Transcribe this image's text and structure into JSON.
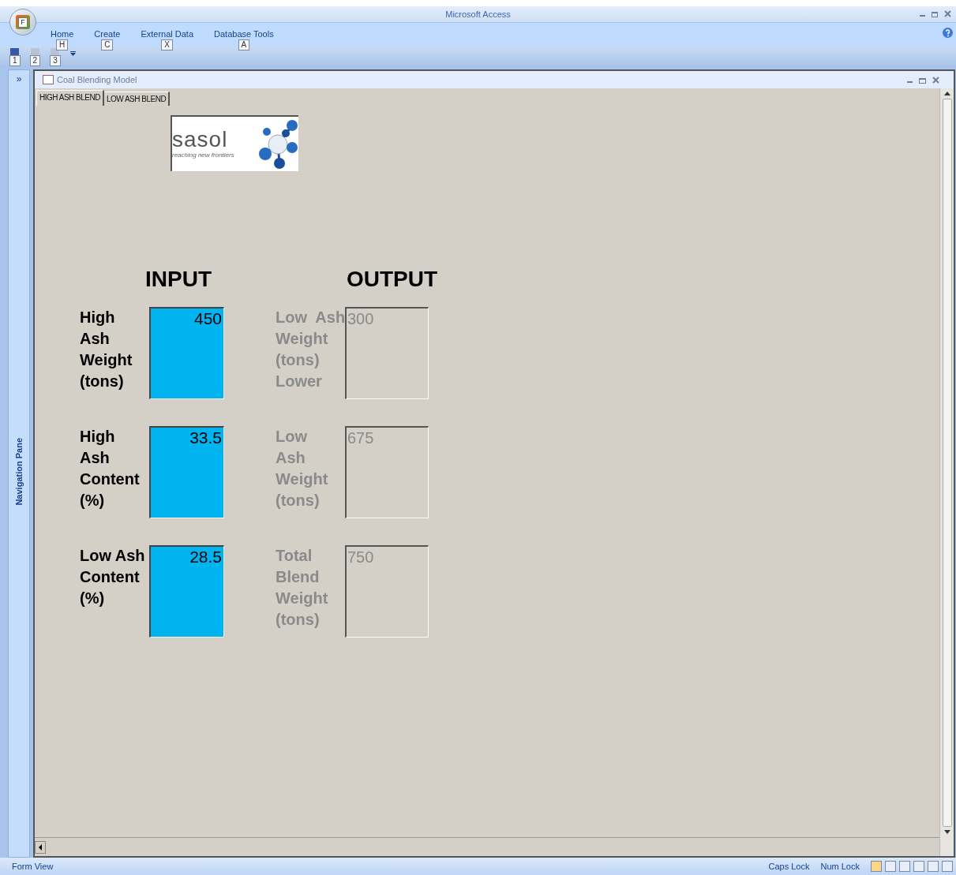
{
  "window": {
    "title": "Microsoft Access",
    "office_button_keytip": "F"
  },
  "ribbon_tabs": [
    {
      "label": "Home",
      "keytip": "H"
    },
    {
      "label": "Create",
      "keytip": "C"
    },
    {
      "label": "External Data",
      "keytip": "X"
    },
    {
      "label": "Database Tools",
      "keytip": "A"
    }
  ],
  "quick_access_keytips": [
    "1",
    "2",
    "3"
  ],
  "navigation_pane": {
    "toggle": "»",
    "label": "Navigation Pane"
  },
  "document": {
    "title": "Coal Blending Model",
    "tabs": [
      {
        "label": "HIGH ASH BLEND",
        "selected": true
      },
      {
        "label": "LOW ASH BLEND",
        "selected": false
      }
    ]
  },
  "logo": {
    "wordmark": "sasol",
    "tagline": "reaching new frontiers"
  },
  "input": {
    "heading": "INPUT",
    "fields": [
      {
        "label": "High\nAsh\nWeight\n(tons)",
        "value": "450"
      },
      {
        "label": "High\nAsh\nContent\n(%)",
        "value": "33.5"
      },
      {
        "label": "Low Ash\nContent\n(%)",
        "value": "28.5"
      }
    ]
  },
  "output": {
    "heading": "OUTPUT",
    "fields": [
      {
        "label": "Low  Ash\nWeight\n(tons)\nLower",
        "value": "300",
        "disabled": true
      },
      {
        "label": "Low\nAsh\nWeight\n(tons)",
        "value": "675",
        "disabled": true
      },
      {
        "label": "Total\nBlend\nWeight\n(tons)",
        "value": "750",
        "disabled": true
      }
    ]
  },
  "status_bar": {
    "mode": "Form View",
    "indicators": [
      "Caps Lock",
      "Num Lock"
    ]
  }
}
